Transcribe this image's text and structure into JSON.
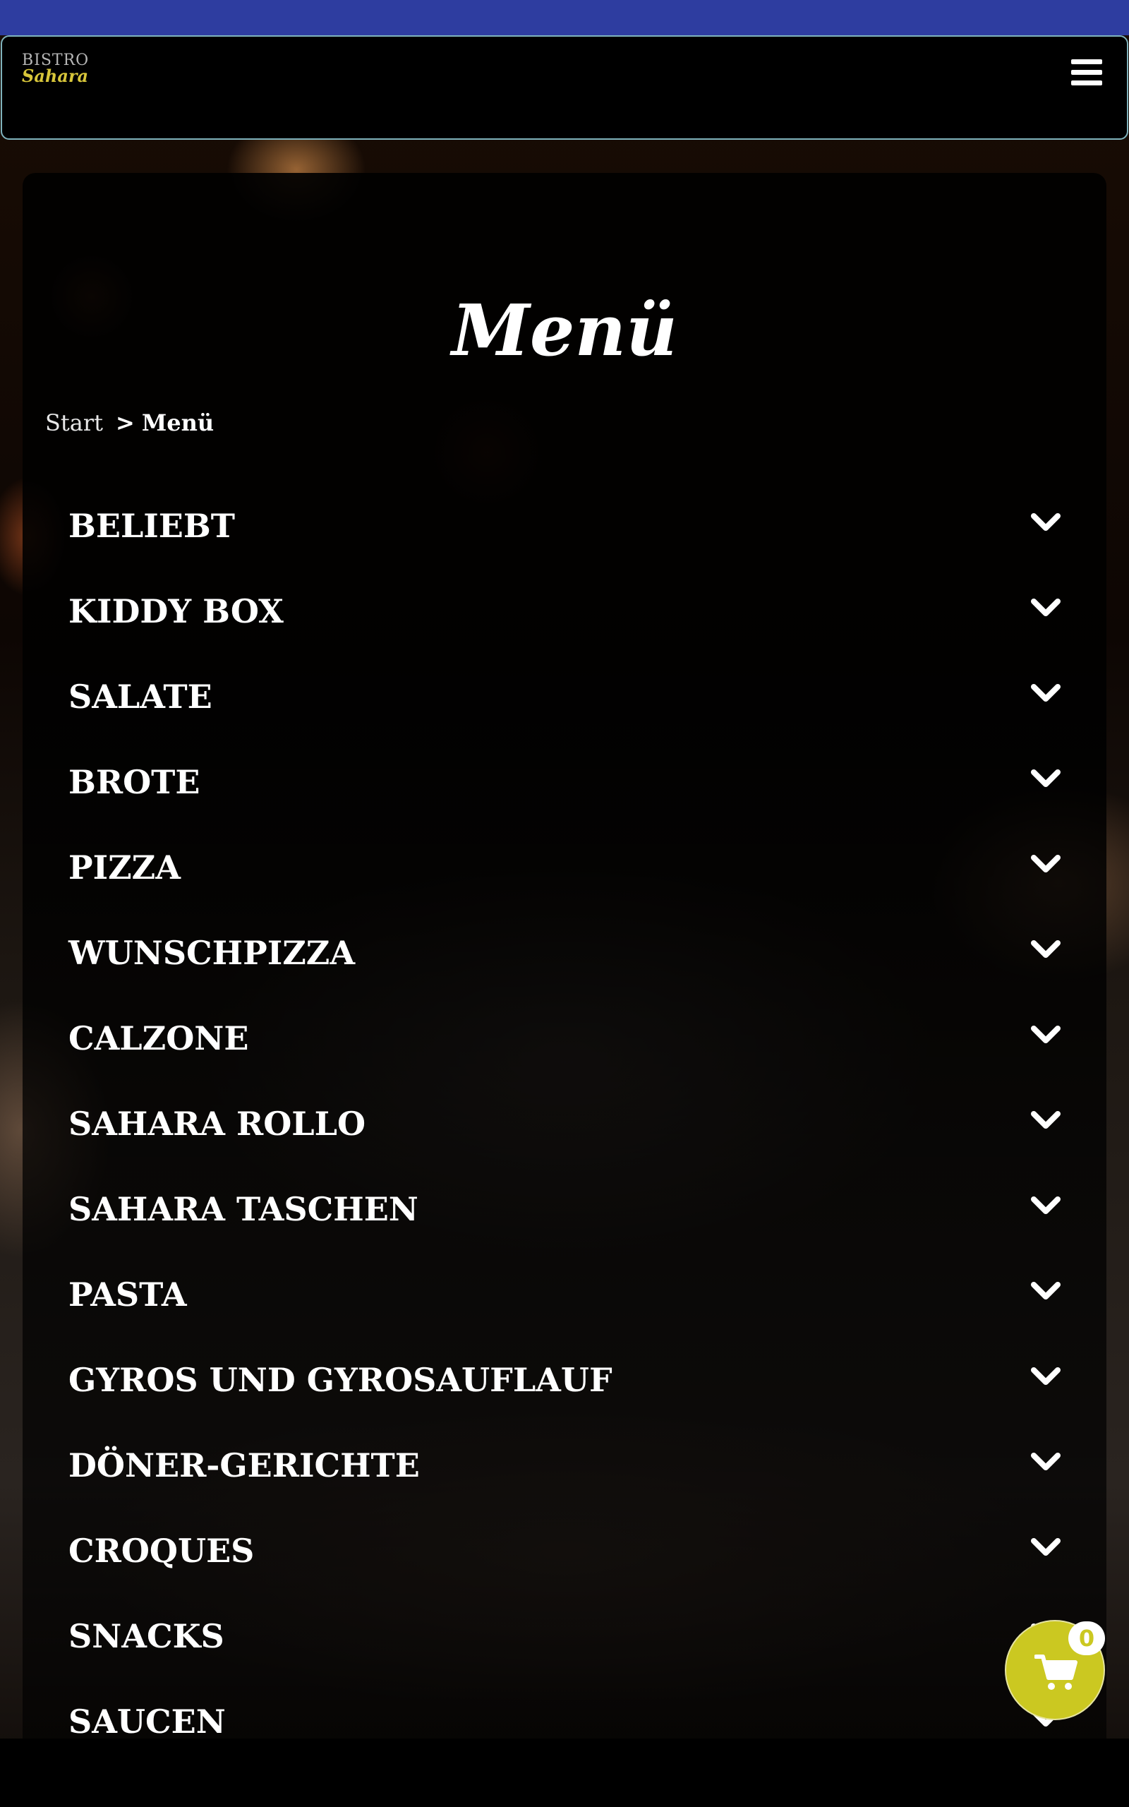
{
  "brand": {
    "logo_line1": "BISTRO",
    "logo_line2": "Sahara",
    "topbar_color": "#2e3da0",
    "accent_color": "#cbc821"
  },
  "header": {
    "menu_icon": "hamburger-icon"
  },
  "page": {
    "title": "Menü"
  },
  "breadcrumb": {
    "start": "Start",
    "separator": ">",
    "current": "Menü"
  },
  "menu": {
    "items": [
      {
        "label": "BELIEBT",
        "icon": "chevron-down-icon"
      },
      {
        "label": "KIDDY BOX",
        "icon": "chevron-down-icon"
      },
      {
        "label": "SALATE",
        "icon": "chevron-down-icon"
      },
      {
        "label": "BROTE",
        "icon": "chevron-down-icon"
      },
      {
        "label": "PIZZA",
        "icon": "chevron-down-icon"
      },
      {
        "label": "WUNSCHPIZZA",
        "icon": "chevron-down-icon"
      },
      {
        "label": "CALZONE",
        "icon": "chevron-down-icon"
      },
      {
        "label": "SAHARA ROLLO",
        "icon": "chevron-down-icon"
      },
      {
        "label": "SAHARA TASCHEN",
        "icon": "chevron-down-icon"
      },
      {
        "label": "PASTA",
        "icon": "chevron-down-icon"
      },
      {
        "label": "GYROS UND GYROSAUFLAUF",
        "icon": "chevron-down-icon"
      },
      {
        "label": "DÖNER-GERICHTE",
        "icon": "chevron-down-icon"
      },
      {
        "label": "CROQUES",
        "icon": "chevron-down-icon"
      },
      {
        "label": "SNACKS",
        "icon": "chevron-down-icon"
      },
      {
        "label": "SAUCEN",
        "icon": "chevron-down-icon"
      }
    ]
  },
  "cart": {
    "count": "0",
    "icon": "shopping-cart-icon"
  }
}
